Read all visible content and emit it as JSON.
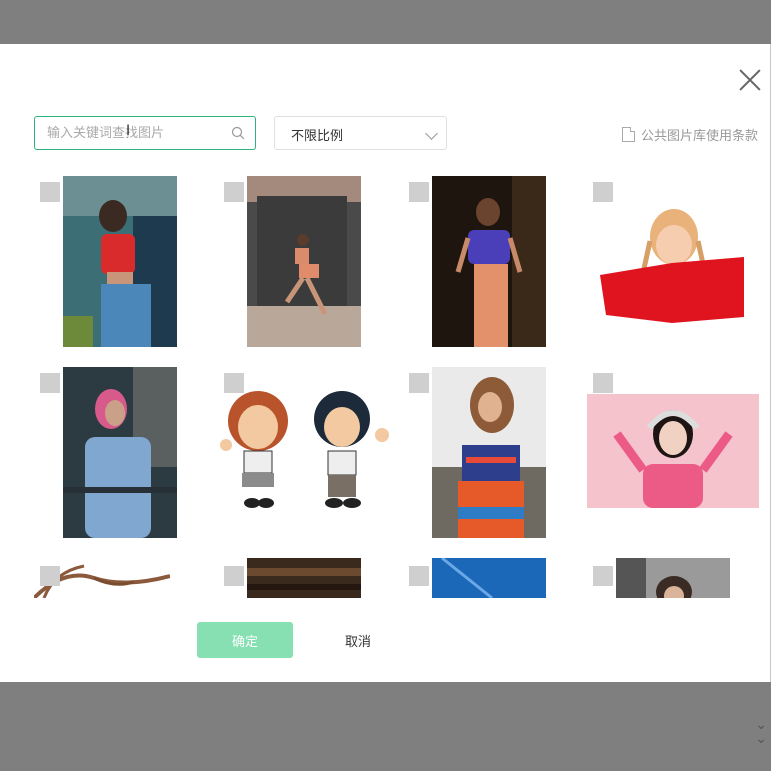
{
  "search": {
    "placeholder": "输入关键词查找图片",
    "value": ""
  },
  "ratio_select": {
    "selected": "不限比例"
  },
  "terms_link": "公共图片库使用条款",
  "buttons": {
    "confirm": "确定",
    "cancel": "取消"
  },
  "images": [
    {
      "id": "woman-red-top",
      "checked": false
    },
    {
      "id": "woman-running",
      "checked": false
    },
    {
      "id": "woman-purple-top",
      "checked": false
    },
    {
      "id": "girl-red-book",
      "checked": false
    },
    {
      "id": "woman-pink-hair-jacket",
      "checked": false
    },
    {
      "id": "cartoon-kids",
      "checked": false
    },
    {
      "id": "woman-embroidered-dress",
      "checked": false
    },
    {
      "id": "woman-headphones-pink",
      "checked": false
    },
    {
      "id": "tree-branches",
      "checked": false
    },
    {
      "id": "dark-wood",
      "checked": false
    },
    {
      "id": "blue-sky",
      "checked": false
    },
    {
      "id": "woman-gray",
      "checked": false
    }
  ],
  "colors": {
    "accent": "#2fb37c",
    "confirm_disabled": "#86e0b2",
    "overlay": "#7f7f7f",
    "checkbox": "#cfcfcf"
  }
}
